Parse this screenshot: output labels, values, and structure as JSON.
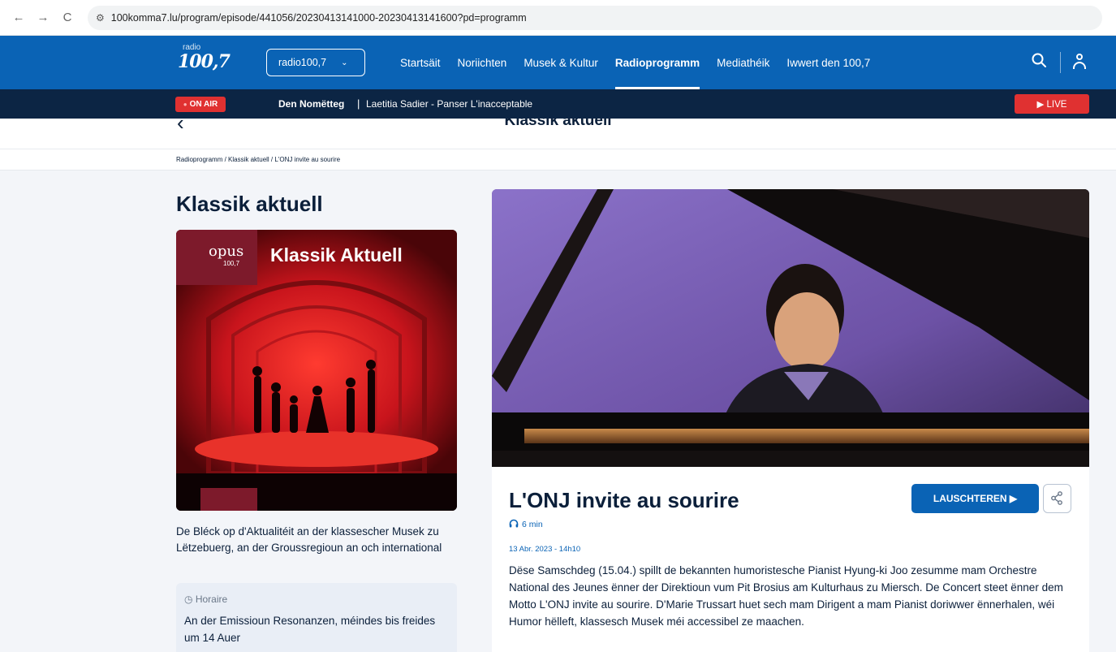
{
  "browser": {
    "back": "←",
    "forward": "→",
    "reload": "C",
    "url": "100komma7.lu/program/episode/441056/20230413141000-20230413141600?pd=programm"
  },
  "nav": {
    "logo_small": "radio",
    "logo_big": "100,7",
    "station": "radio100,7",
    "links": [
      "Startsäit",
      "Noriichten",
      "Musek & Kultur",
      "Radioprogramm",
      "Mediathéik",
      "Iwwert den 100,7"
    ],
    "active_link": "Radioprogramm"
  },
  "onair": {
    "badge": "ON AIR",
    "show": "Den Nomëtteg",
    "separator": "|",
    "track": "Laetitia Sadier - Panser L'inacceptable",
    "live": "▶ LIVE"
  },
  "sub_header": {
    "title": "Klassik aktuell"
  },
  "breadcrumb": {
    "text": "Radioprogramm / Klassik aktuell / L'ONJ invite au sourire"
  },
  "show": {
    "title": "Klassik aktuell",
    "cover_brand": "opus",
    "cover_brand_sub": "100,7",
    "cover_title": "Klassik Aktuell",
    "description": "De Bléck op d'Aktualitéit an der klassescher Musek zu Lëtzebuerg, an der Groussregioun an och international",
    "horaire_label": "Horaire",
    "horaire_text": "An der Emissioun Resonanzen, méindes bis freides um 14 Auer"
  },
  "episode": {
    "title": "L'ONJ invite au sourire",
    "listen": "LAUSCHTEREN ▶",
    "duration": "6 min",
    "date": "13 Abr. 2023 - 14h10",
    "text": "Dëse Samschdeg (15.04.) spillt de bekannten humoristesche Pianist Hyung-ki Joo zesumme mam Orchestre National des Jeunes ënner der Direktioun vum Pit Brosius am Kulturhaus zu Miersch. De Concert steet ënner dem Motto L'ONJ invite au sourire. D'Marie Trussart huet sech mam Dirigent a mam Pianist doriwwer ënnerhalen, wéi Humor hëlleft, klassesch Musek méi accessibel ze maachen."
  },
  "colors": {
    "brand_blue": "#0a63b5",
    "navy": "#0c2544",
    "live_red": "#e03131",
    "cover_red": "#c8141c",
    "photo_purple": "#6e4ea4"
  }
}
